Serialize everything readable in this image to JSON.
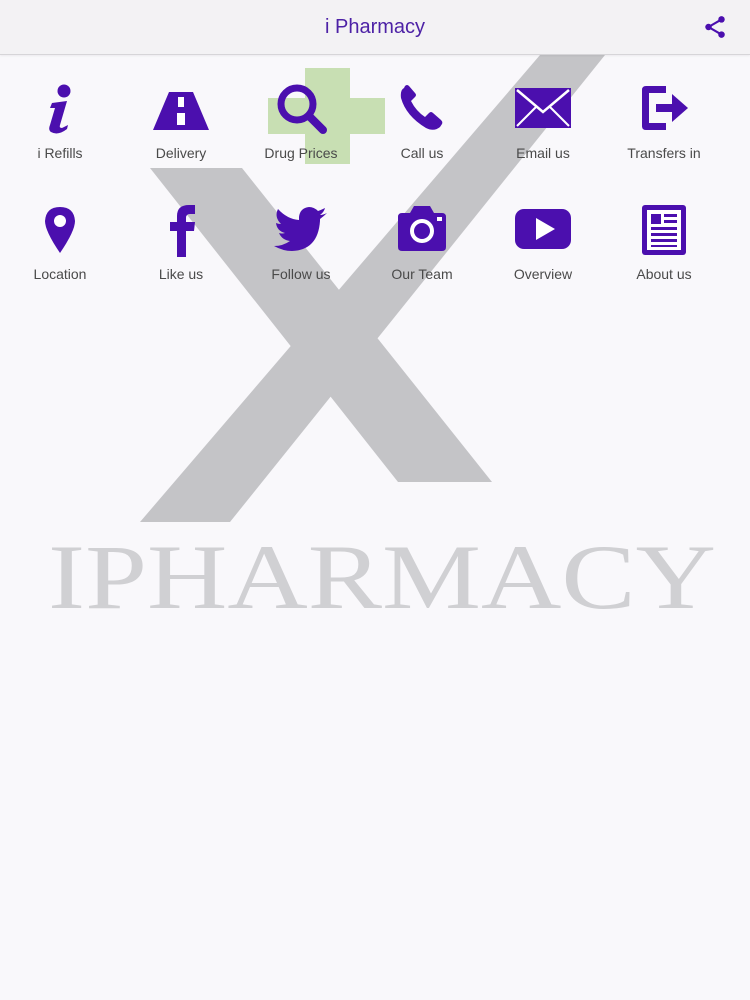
{
  "header": {
    "title": "i Pharmacy",
    "share_icon": "share-icon"
  },
  "watermark": {
    "brand_text": "IPHARMACY"
  },
  "colors": {
    "accent": "#4b0fae",
    "label": "#4a4a4a",
    "background": "#f9f8fb",
    "watermark_gray": "#c4c4c7",
    "watermark_cross": "#c8dfb3"
  },
  "tiles": [
    {
      "label": "i Refills",
      "icon": "info-icon"
    },
    {
      "label": "Delivery",
      "icon": "road-icon"
    },
    {
      "label": "Drug Prices",
      "icon": "search-icon"
    },
    {
      "label": "Call us",
      "icon": "phone-icon"
    },
    {
      "label": "Email us",
      "icon": "envelope-icon"
    },
    {
      "label": "Transfers in",
      "icon": "sign-in-icon"
    },
    {
      "label": "Location",
      "icon": "map-pin-icon"
    },
    {
      "label": "Like us",
      "icon": "facebook-icon"
    },
    {
      "label": "Follow us",
      "icon": "twitter-icon"
    },
    {
      "label": "Our Team",
      "icon": "camera-icon"
    },
    {
      "label": "Overview",
      "icon": "youtube-play-icon"
    },
    {
      "label": "About us",
      "icon": "newspaper-icon"
    }
  ]
}
